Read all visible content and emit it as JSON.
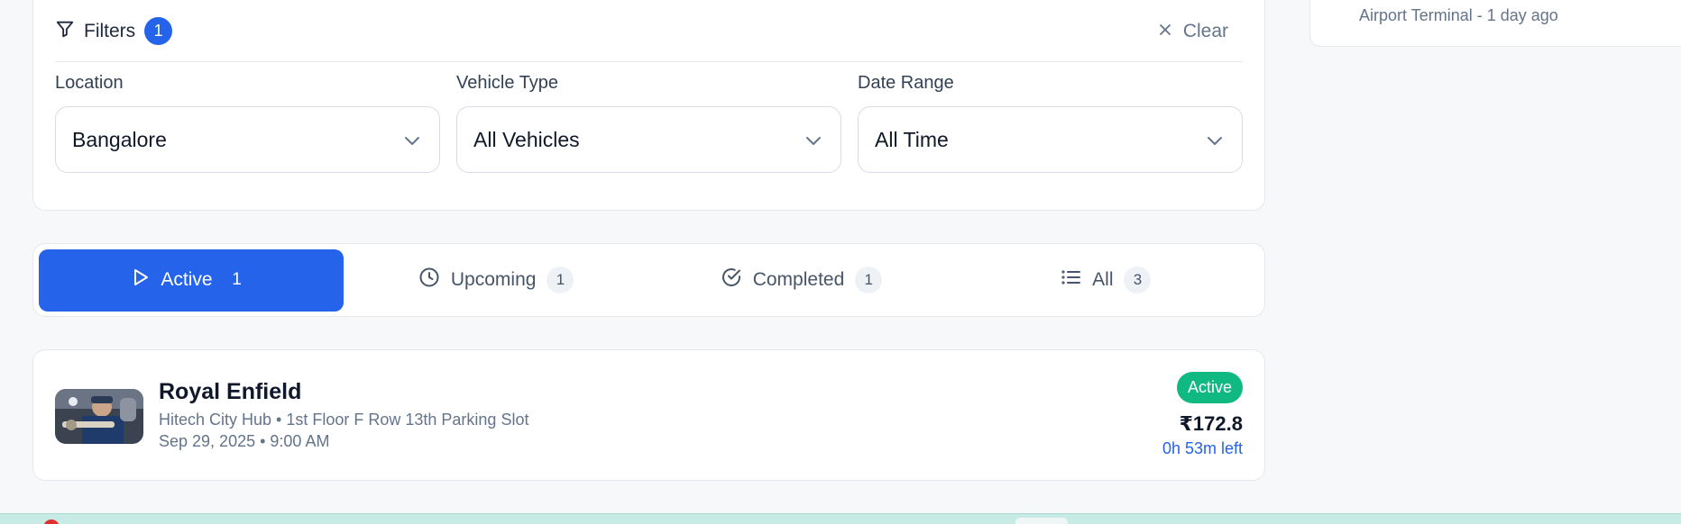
{
  "filters": {
    "title": "Filters",
    "count": "1",
    "clear_label": "Clear",
    "location": {
      "label": "Location",
      "value": "Bangalore"
    },
    "vehicle_type": {
      "label": "Vehicle Type",
      "value": "All Vehicles"
    },
    "date_range": {
      "label": "Date Range",
      "value": "All Time"
    }
  },
  "tabs": [
    {
      "label": "Active",
      "count": "1",
      "icon": "play-icon",
      "selected": true
    },
    {
      "label": "Upcoming",
      "count": "1",
      "icon": "clock-icon",
      "selected": false
    },
    {
      "label": "Completed",
      "count": "1",
      "icon": "check-circle-icon",
      "selected": false
    },
    {
      "label": "All",
      "count": "3",
      "icon": "list-icon",
      "selected": false
    }
  ],
  "booking": {
    "vehicle": "Royal Enfield",
    "location": "Hitech City Hub • 1st Floor F Row 13th Parking Slot",
    "datetime": "Sep 29, 2025 • 9:00 AM",
    "status": "Active",
    "price": "₹172.8",
    "time_left": "0h 53m left"
  },
  "side_panel": {
    "activity_text": "Airport Terminal - 1 day ago"
  },
  "colors": {
    "accent": "#2563eb",
    "success": "#10b981",
    "background": "#f7f8fa"
  }
}
